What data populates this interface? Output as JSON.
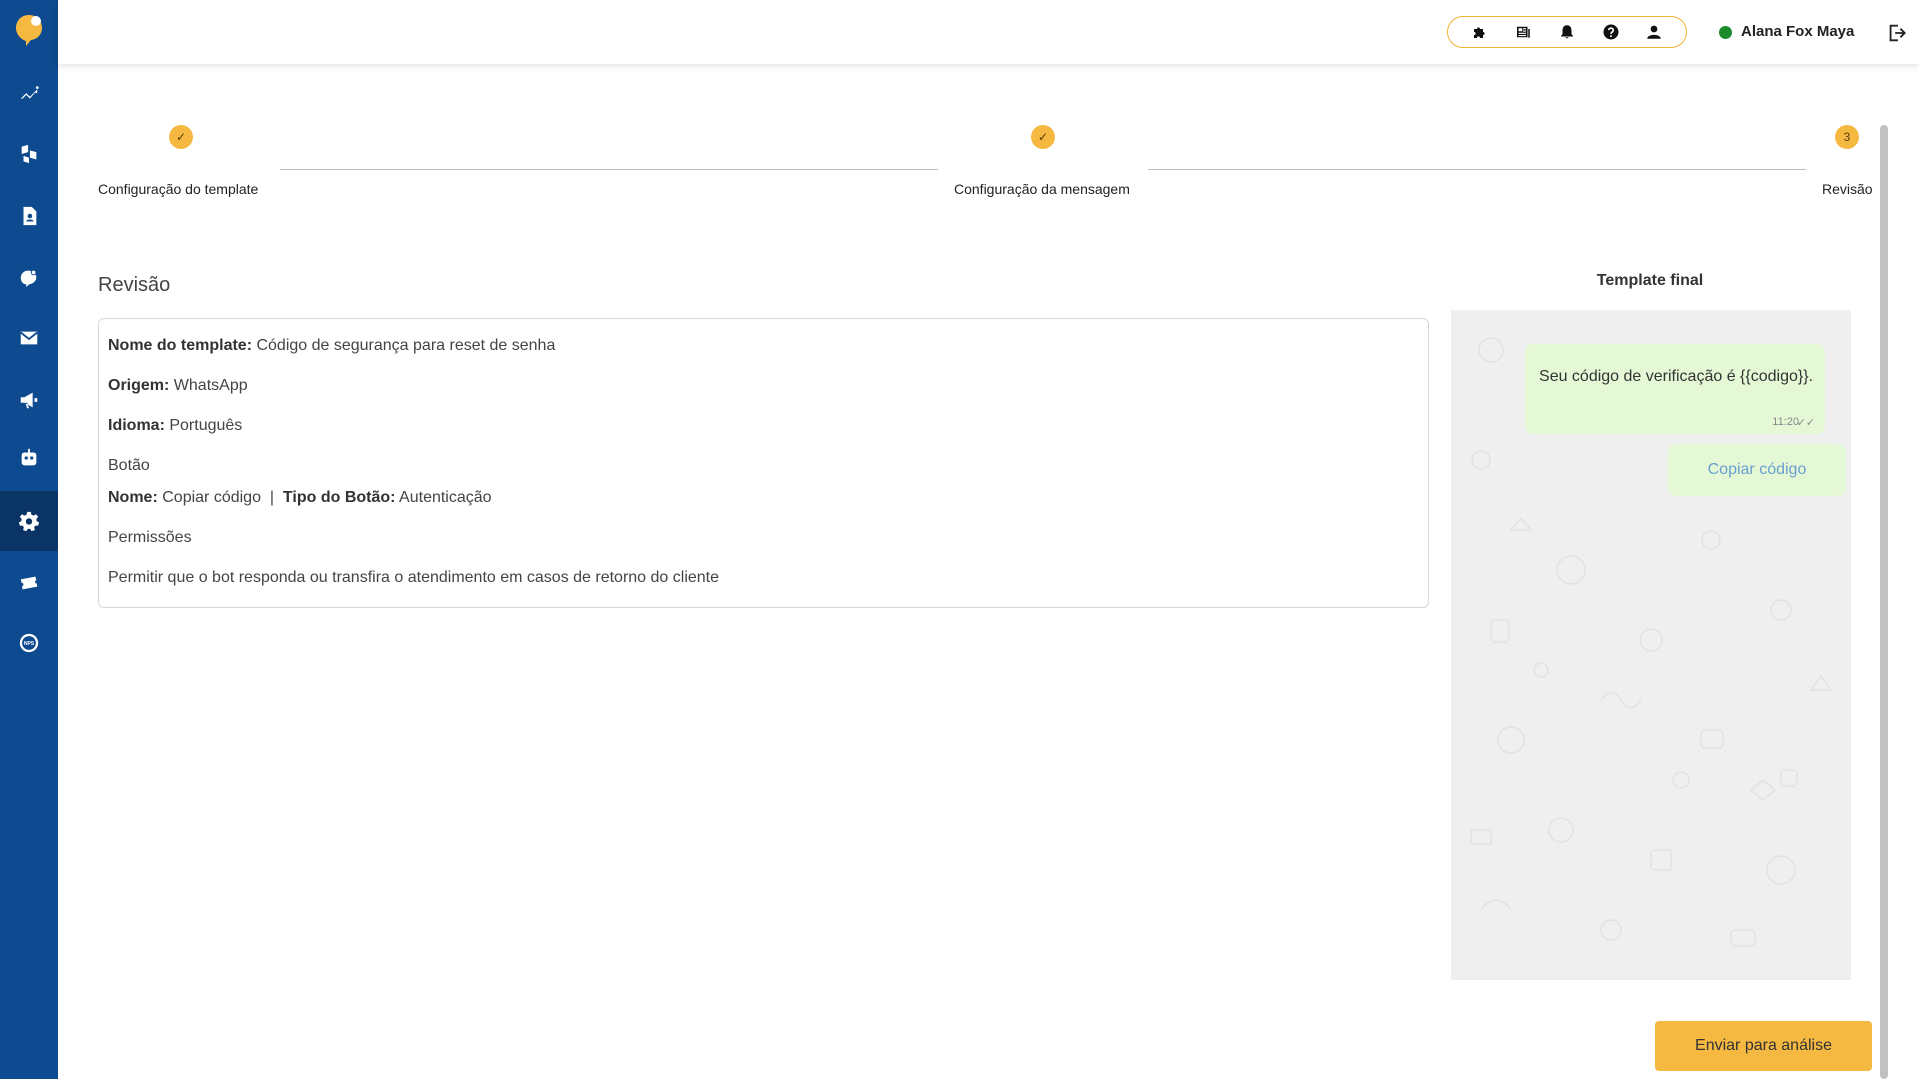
{
  "header": {
    "user_name": "Alana Fox Maya",
    "status_color": "#1a8a2a",
    "icons": [
      "puzzle-icon",
      "news-icon",
      "bell-icon",
      "help-icon",
      "user-icon"
    ]
  },
  "sidebar": {
    "items": [
      "chart-icon",
      "boxes-icon",
      "contact-icon",
      "chat-icon",
      "mail-icon",
      "megaphone-icon",
      "bot-icon",
      "gear-icon",
      "ticket-icon",
      "nps-icon"
    ],
    "active": "gear-icon",
    "brand_color": "#0d4a8f"
  },
  "stepper": {
    "steps": [
      {
        "label": "Configuração do template",
        "state": "done",
        "marker": "✓"
      },
      {
        "label": "Configuração da mensagem",
        "state": "done",
        "marker": "✓"
      },
      {
        "label": "Revisão",
        "state": "current",
        "marker": "3"
      }
    ]
  },
  "review": {
    "title": "Revisão",
    "template_name_label": "Nome do template:",
    "template_name": "Código de segurança para reset de senha",
    "origin_label": "Origem:",
    "origin": "WhatsApp",
    "language_label": "Idioma:",
    "language": "Português",
    "button_heading": "Botão",
    "button_name_label": "Nome:",
    "button_name": "Copiar código",
    "separator": "|",
    "button_type_label": "Tipo do Botão:",
    "button_type": "Autenticação",
    "permissions_heading": "Permissões",
    "permissions_text": "Permitir que o bot responda ou transfira o atendimento em casos de retorno do cliente"
  },
  "preview": {
    "title": "Template final",
    "message": "Seu código de verificação é {{codigo}}.",
    "time": "11:20",
    "check": "✓✓",
    "button_label": "Copiar código"
  },
  "actions": {
    "submit_label": "Enviar para análise",
    "accent": "#f5b942"
  }
}
